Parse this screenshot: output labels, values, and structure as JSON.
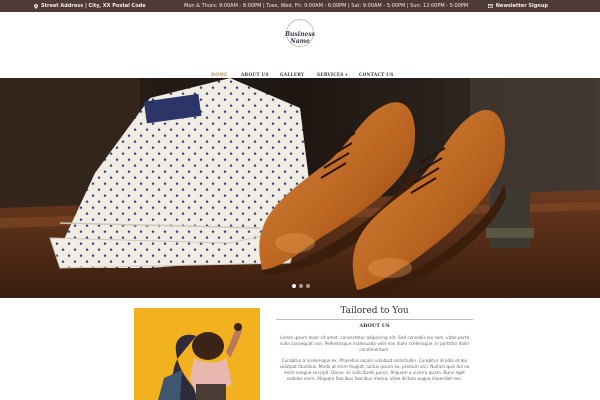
{
  "topbar": {
    "address": "Street Address | City, XX Postal Code",
    "hours": "Mon & Thurs: 9:00AM - 8:00PM | Tues, Wed, Fri: 9:00AM - 6:00PM | Sat: 9:00AM - 5:00PM | Sun: 12:00PM - 5:00PM",
    "newsletter": "Newsletter Signup",
    "address_icon": "map-pin-icon",
    "newsletter_icon": "envelope-icon"
  },
  "header": {
    "logo_text": "Business Name"
  },
  "nav": {
    "items": [
      "HOME",
      "ABOUT US",
      "GALLERY",
      "SERVICES ▾",
      "CONTACT US"
    ],
    "active_index": 0
  },
  "slider": {
    "slide_count": 3,
    "active_slide": 1
  },
  "section": {
    "title": "Tailored to You",
    "heading": "ABOUT US",
    "paragraph1": "Lorem ipsum dolor sit amet, consectetur adipiscing elit. Sed convallis leo sem, vitae porta nulla consequat non. Pellentesque malesuada velit non diam scelerisque, in porttitor dolor condimentum.",
    "paragraph2": "Curabitur a scelerisque ex. Phasellus iaculis volutpat sollicitudin. Curabitur id odio et dui volutpat faucibus. Morbi at enim feugiat, luctus ipsum eu, pretium orci. Nullam quis dui eu enim congue suscipit. Donec ac sollicitudin purus. Aliquam a viverra quam. Nunc eget sodales enim. Aliquam faucibus faucibus massa, vitae dictum augue imperdiet nec."
  },
  "colors": {
    "topbar": "#4e3a36",
    "accent": "#b08a5a",
    "photo_bg": "#f2b21f"
  }
}
